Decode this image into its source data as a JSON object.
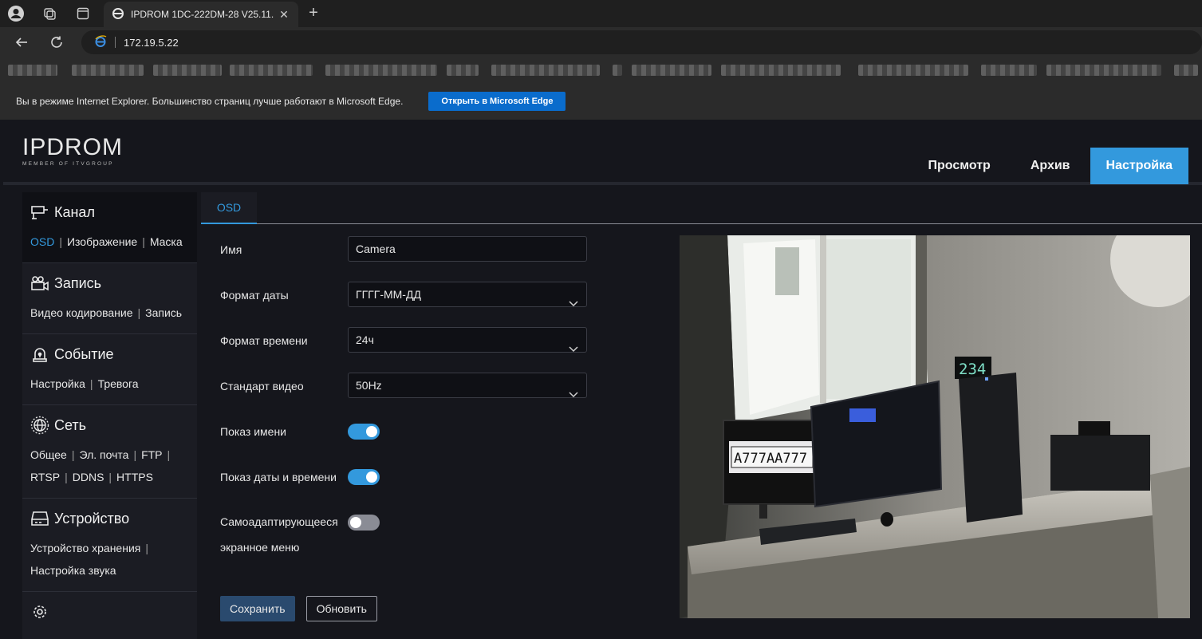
{
  "browser": {
    "tab_title": "IPDROM 1DC-222DM-28 V25.11.",
    "url": "172.19.5.22",
    "ie_notice": "Вы в режиме Internet Explorer. Большинство страниц лучше работают в Microsoft Edge.",
    "ie_button": "Открыть в Microsoft Edge"
  },
  "header": {
    "logo_text": "IPDROM",
    "logo_sub": "MEMBER OF ITVGROUP",
    "nav": [
      {
        "label": "Просмотр"
      },
      {
        "label": "Архив"
      },
      {
        "label": "Настройка"
      }
    ]
  },
  "sidebar": {
    "sections": [
      {
        "title": "Канал",
        "links": [
          "OSD",
          "Изображение",
          "Маска"
        ]
      },
      {
        "title": "Запись",
        "links": [
          "Видео кодирование",
          "Запись"
        ]
      },
      {
        "title": "Событие",
        "links": [
          "Настройка",
          "Тревога"
        ]
      },
      {
        "title": "Сеть",
        "links": [
          "Общее",
          "Эл. почта",
          "FTP",
          "RTSP",
          "DDNS",
          "HTTPS"
        ]
      },
      {
        "title": "Устройство",
        "links": [
          "Устройство хранения",
          "Настройка звука"
        ]
      }
    ]
  },
  "content": {
    "tab": "OSD",
    "fields": {
      "name_label": "Имя",
      "name_value": "Camera",
      "date_label": "Формат даты",
      "date_value": "ГГГГ-ММ-ДД",
      "time_label": "Формат времени",
      "time_value": "24ч",
      "video_label": "Стандарт видео",
      "video_value": "50Hz",
      "show_name_label": "Показ имени",
      "show_datetime_label": "Показ даты и времени",
      "adaptive_label_1": "Самоадаптирующееся",
      "adaptive_label_2": "экранное меню"
    },
    "toggles": {
      "show_name": true,
      "show_datetime": true,
      "adaptive": false
    },
    "buttons": {
      "save": "Сохранить",
      "refresh": "Обновить"
    },
    "preview": {
      "clock_text": "234",
      "plate_text": "A777AA777"
    }
  }
}
